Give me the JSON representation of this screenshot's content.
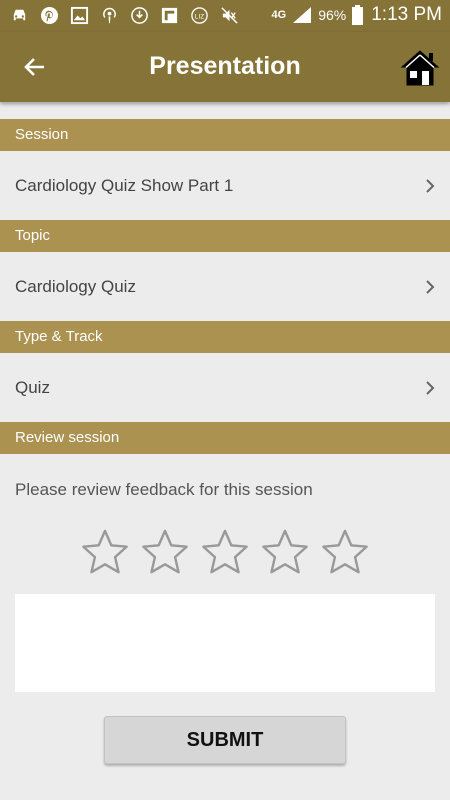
{
  "status_bar": {
    "network": "4G",
    "battery_percent": "96%",
    "time": "1:13 PM",
    "icons": [
      "car-icon",
      "pinterest-icon",
      "image-icon",
      "podcast-icon",
      "download-icon",
      "flipboard-icon",
      "badge-icon",
      "mute-icon",
      "signal-icon",
      "battery-icon"
    ]
  },
  "app_bar": {
    "title": "Presentation",
    "back_icon": "arrow-left-icon",
    "home_icon": "home-icon"
  },
  "sections": {
    "session": {
      "header": "Session",
      "value": "Cardiology Quiz Show Part 1"
    },
    "topic": {
      "header": "Topic",
      "value": "Cardiology Quiz"
    },
    "type_track": {
      "header": "Type & Track",
      "value": "Quiz"
    },
    "review": {
      "header": "Review session",
      "prompt": "Please review feedback for this session"
    }
  },
  "rating": {
    "max": 5,
    "value": 0
  },
  "feedback": {
    "value": "",
    "placeholder": ""
  },
  "submit_label": "SUBMIT",
  "colors": {
    "app_bar": "#857337",
    "section_header": "#ab9250",
    "background": "#ececec"
  }
}
